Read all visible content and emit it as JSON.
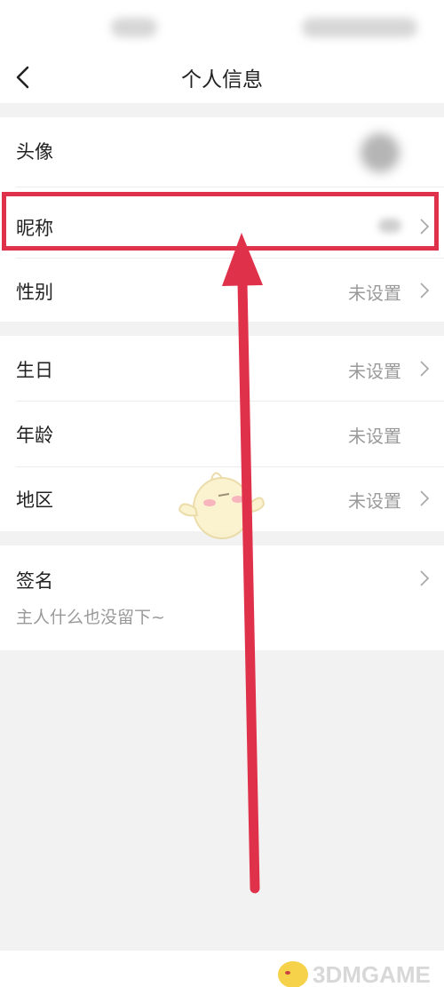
{
  "nav": {
    "title": "个人信息"
  },
  "rows": {
    "avatar": {
      "label": "头像"
    },
    "nickname": {
      "label": "昵称"
    },
    "gender": {
      "label": "性别",
      "value": "未设置"
    },
    "birthday": {
      "label": "生日",
      "value": "未设置"
    },
    "age": {
      "label": "年龄",
      "value": "未设置"
    },
    "region": {
      "label": "地区",
      "value": "未设置"
    },
    "signature": {
      "label": "签名",
      "value": "主人什么也没留下~"
    }
  },
  "watermark": {
    "text": "3DMGAME"
  },
  "colors": {
    "highlight": "#e0314a",
    "background": "#f2f2f2",
    "value_text": "#9a9a9a"
  },
  "icons": [
    "back-arrow-icon",
    "chevron-right-icon",
    "mascot-icon"
  ]
}
